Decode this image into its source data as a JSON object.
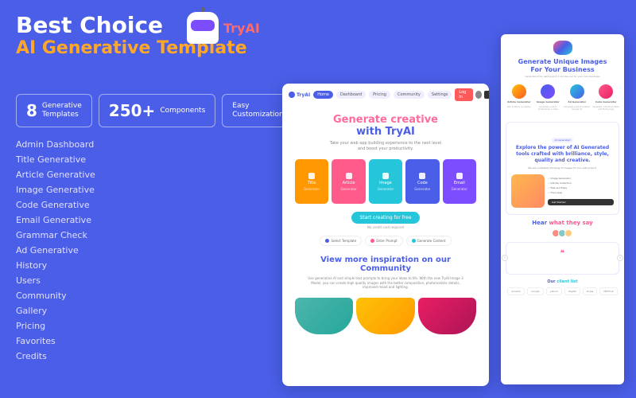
{
  "header": {
    "title1": "Best Choice",
    "title2": "AI Generative Template",
    "brand": "TryAI"
  },
  "stats": [
    {
      "num": "8",
      "label": "Generative\nTemplates"
    },
    {
      "num": "250+",
      "label": "Components"
    },
    {
      "num": "",
      "label": "Easy\nCustomization"
    }
  ],
  "features": [
    "Admin Dashboard",
    "Title Generative",
    "Article Generative",
    "Image Generative",
    "Code Generative",
    "Email Generative",
    "Grammar Check",
    "Ad Generative",
    "History",
    "Users",
    "Community",
    "Gallery",
    "Pricing",
    "Favorites",
    "Credits"
  ],
  "preview1": {
    "logo": "TryAI",
    "nav": [
      "Home",
      "Dashboard",
      "Pricing",
      "Community",
      "Settings"
    ],
    "login": "Log In",
    "hero1": "Generate creative",
    "hero2": "with TryAI",
    "sub": "Take your web app building experience to the next level\nand boost your productivity.",
    "cats": [
      {
        "label": "Title",
        "sub": "Generator"
      },
      {
        "label": "Article",
        "sub": "Generator"
      },
      {
        "label": "Image",
        "sub": "Generator"
      },
      {
        "label": "Code",
        "sub": "Generator"
      },
      {
        "label": "Email",
        "sub": "Generator"
      }
    ],
    "cta": "Start creating for free",
    "cta_sub": "No credit card required",
    "steps": [
      "Select Template",
      "Enter Prompt",
      "Generate Content"
    ],
    "h2": "View more inspiration on our Community",
    "desc": "Use generative AI and simple text prompts to bring your ideas to life. With the new TryAI Image 3 Model, you can create high quality images with the better composition, photorealistic details, improved mood and lighting."
  },
  "preview2": {
    "h1a": "Generate Unique Images",
    "h1b": "For Your Business",
    "sub": "Generate AI by asking and it can be use for your own business",
    "icons": [
      {
        "label": "Article Generator",
        "desc": "Turn a title to an outline"
      },
      {
        "label": "Image Generator",
        "desc": "Generate a list of professional e-mails"
      },
      {
        "label": "Ad Generator",
        "desc": "Generate a list of creative Google Ad"
      },
      {
        "label": "Code Generator",
        "desc": "Generate code fix problem and finding bug"
      }
    ],
    "badge": "AI Generated",
    "h2": "Explore the power of AI Generated tools crafted with brilliance, style, quality and creative.",
    "tiny": "We are constantly thinking of images for our next project.",
    "bullets": [
      "Image Generator",
      "Infinite Collection",
      "Fast and Easy",
      "Free Apps"
    ],
    "getstarted": "Get Started",
    "hear": "Hear what they say",
    "clients_h": "Our client list",
    "clients": [
      "amazon",
      "Google",
      "yahoo!",
      "PayPal",
      "stripe",
      "NETFLIX"
    ]
  }
}
